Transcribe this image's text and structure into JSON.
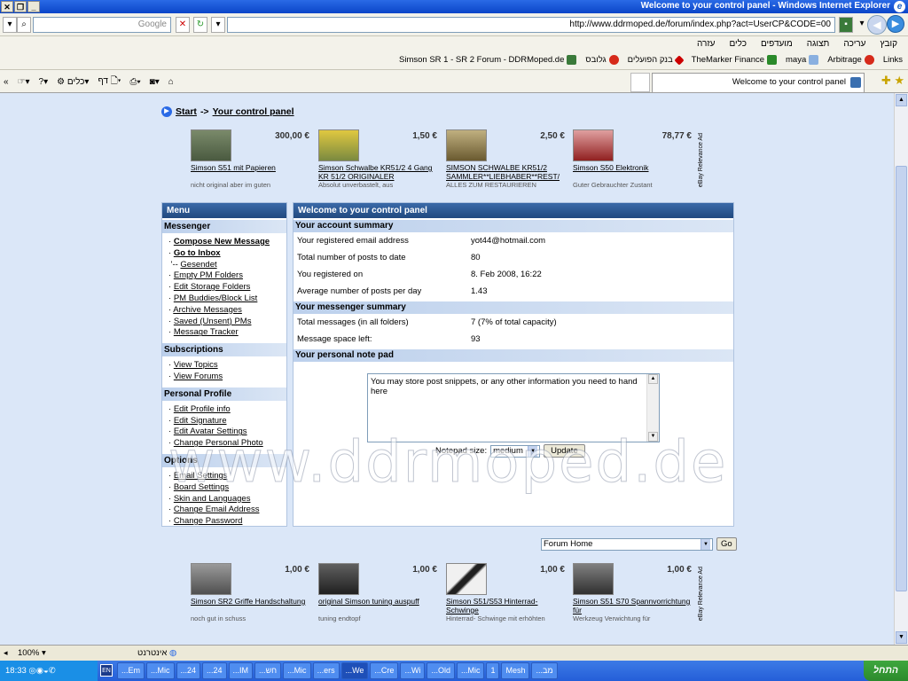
{
  "window": {
    "title": "Welcome to your control panel - Windows Internet Explorer"
  },
  "toolbar": {
    "search_placeholder": "Google",
    "address": "http://www.ddrmoped.de/forum/index.php?act=UserCP&CODE=00"
  },
  "menubar": {
    "items": [
      "קובץ",
      "עריכה",
      "תצוגה",
      "מועדפים",
      "כלים",
      "עזרה"
    ]
  },
  "links": {
    "items": [
      "Links",
      "Arbitrage",
      "maya",
      "TheMarker Finance",
      "בנק הפועלים",
      "גלובס",
      "Simson SR 1 - SR 2 Forum - DDRMoped.de"
    ]
  },
  "commandbar": {
    "tools": "כלים",
    "page": "דף"
  },
  "tab": {
    "title": "Welcome to your control panel"
  },
  "breadcrumb": {
    "start": "Start",
    "sep": "->",
    "current": "Your control panel"
  },
  "ebay_top": {
    "label": "eBay Relevance Ad",
    "items": [
      {
        "price": "300,00 €",
        "title": "Simson S51 mit Papieren",
        "desc": "nicht original aber im guten",
        "color": "#5a6a50"
      },
      {
        "price": "1,50 €",
        "title": "Simson Schwalbe KR51/2 4 Gang KR 51/2 ORIGINALER",
        "desc": "Absolut unverbastelt, aus",
        "color": "#c9b02a"
      },
      {
        "price": "2,50 €",
        "title": "SIMSON SCHWALBE KR51/2 SAMMLER**LIEBHABER**REST/",
        "desc": "ALLES ZUM RESTAURIEREN",
        "color": "#8a7a50"
      },
      {
        "price": "78,77 €",
        "title": "Simson S50 Elektronik",
        "desc": "Guter Gebrauchter Zustant",
        "color": "#a03030"
      }
    ]
  },
  "ebay_bottom": {
    "label": "eBay Relevance Ad",
    "items": [
      {
        "price": "1,00 €",
        "title": "Simson SR2 Griffe Handschaltung",
        "desc": "noch gut in schuss",
        "color": "#707070"
      },
      {
        "price": "1,00 €",
        "title": "original Simson tuning auspuff",
        "desc": "tuning endtopf",
        "color": "#404040"
      },
      {
        "price": "1,00 €",
        "title": "Simson S51/S53 Hinterrad-Schwinge",
        "desc": "Hinterrad- Schwinge mit erhöhten",
        "color": "#e8e8e8"
      },
      {
        "price": "1,00 €",
        "title": "Simson S51 S70 Spannvorrichtung für",
        "desc": "Werkzeug Verwichtung für",
        "color": "#505050"
      }
    ]
  },
  "menu": {
    "title": "Menu",
    "sections": [
      {
        "title": "Messenger",
        "items": [
          "Compose New Message",
          "Go to Inbox",
          "Gesendet",
          "Empty PM Folders",
          "Edit Storage Folders",
          "PM Buddies/Block List",
          "Archive Messages",
          "Saved (Unsent) PMs",
          "Message Tracker"
        ]
      },
      {
        "title": "Subscriptions",
        "items": [
          "View Topics",
          "View Forums"
        ]
      },
      {
        "title": "Personal Profile",
        "items": [
          "Edit Profile info",
          "Edit Signature",
          "Edit Avatar Settings",
          "Change Personal Photo"
        ]
      },
      {
        "title": "Options",
        "items": [
          "Email Settings",
          "Board Settings",
          "Skin and Languages",
          "Change Email Address",
          "Change Password"
        ]
      }
    ]
  },
  "panel": {
    "title": "Welcome to your control panel",
    "account": {
      "title": "Your account summary",
      "rows": [
        {
          "k": "Your registered email address",
          "v": "yot44@hotmail.com"
        },
        {
          "k": "Total number of posts to date",
          "v": "80"
        },
        {
          "k": "You registered on",
          "v": "8. Feb 2008, 16:22"
        },
        {
          "k": "Average number of posts per day",
          "v": "1.43"
        }
      ]
    },
    "messenger": {
      "title": "Your messenger summary",
      "rows": [
        {
          "k": "Total messages (in all folders)",
          "v": "7 (7% of total capacity)"
        },
        {
          "k": "Message space left:",
          "v": "93"
        }
      ]
    },
    "notepad": {
      "title": "Your personal note pad",
      "text": "You may store post snippets, or any other information you need to hand here",
      "size_label": "Notepad size:",
      "size_value": "medium",
      "update": "Update"
    }
  },
  "forumjump": {
    "value": "Forum Home",
    "go": "Go"
  },
  "watermark": "www.ddrmoped.de",
  "status": {
    "zoom": "100%",
    "zone": "אינטרנט"
  },
  "taskbar": {
    "start": "התחל",
    "clock": "18:33",
    "lang": "EN",
    "tasks": [
      "...Em",
      "...Mic",
      "...24",
      "...24",
      "...IM",
      "...חש",
      "...Mic",
      "...ers",
      "...We",
      "...Cre",
      "...Wi",
      "...Old",
      "...Mic",
      "1",
      "Mesh",
      "...מב"
    ]
  }
}
